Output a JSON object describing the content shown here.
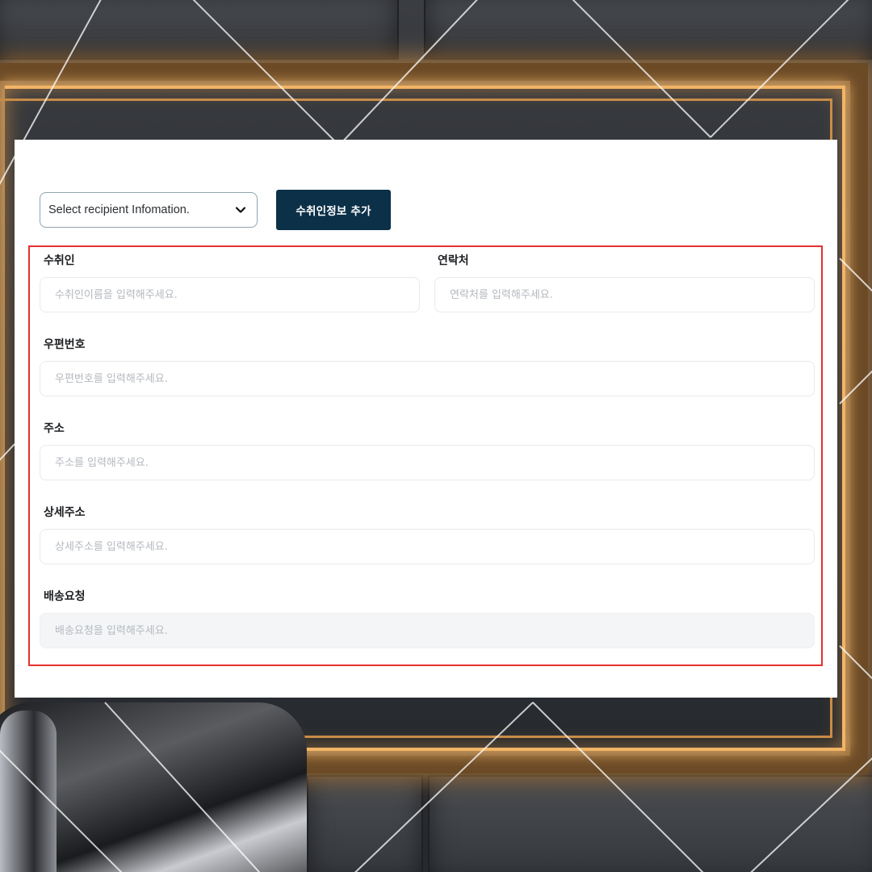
{
  "toolbar": {
    "recipient_select": "Select recipient Infomation.",
    "add_button": "수취인정보 추가"
  },
  "form": {
    "recipient": {
      "label": "수취인",
      "placeholder": "수취인이름을 입력해주세요."
    },
    "contact": {
      "label": "연락처",
      "placeholder": "연락처를 입력해주세요."
    },
    "postal_code": {
      "label": "우편번호",
      "placeholder": "우편번호를 입력해주세요."
    },
    "address": {
      "label": "주소",
      "placeholder": "주소를 입력해주세요."
    },
    "detail_address": {
      "label": "상세주소",
      "placeholder": "상세주소를 입력해주세요."
    },
    "delivery_request": {
      "label": "배송요청",
      "placeholder": "배송요청을 입력해주세요."
    }
  },
  "colors": {
    "primary_button": "#0c3048",
    "highlight_border": "#e5312f",
    "frame_glow": "#f2b566"
  },
  "icons": {
    "select_chevron": "chevron-down-icon"
  }
}
